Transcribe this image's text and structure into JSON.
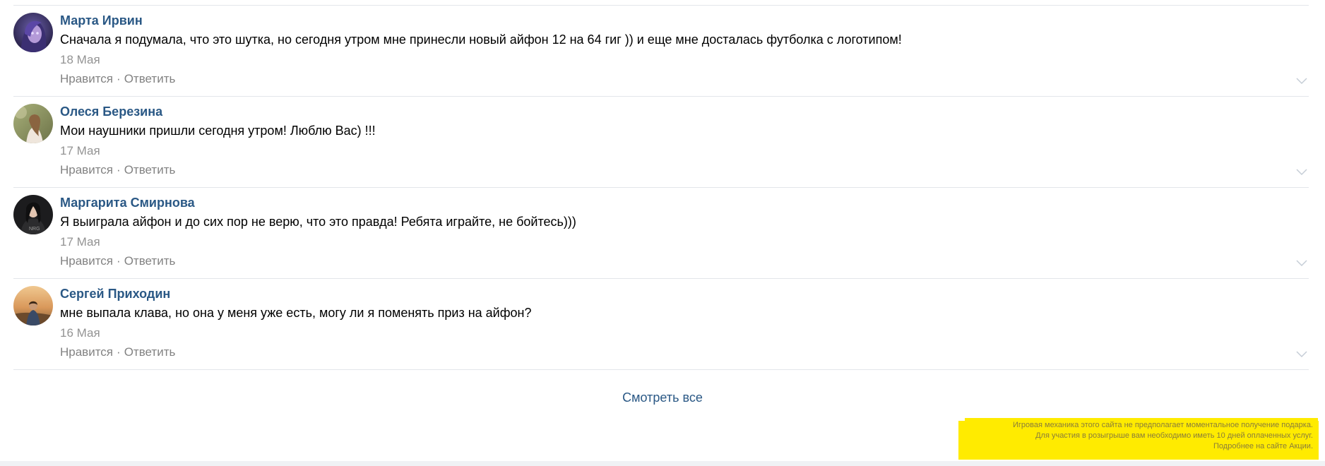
{
  "comments": [
    {
      "author": "Марта Ирвин",
      "text": "Сначала я подумала, что это шутка, но сегодня утром мне принесли новый айфон 12 на 64 гиг )) и еще мне досталась футболка с логотипом!",
      "date": "18 Мая",
      "like": "Нравится",
      "reply": "Ответить",
      "separator": "·"
    },
    {
      "author": "Олеся Березина",
      "text": "Мои наушники пришли сегодня утром! Люблю Вас) !!!",
      "date": "17 Мая",
      "like": "Нравится",
      "reply": "Ответить",
      "separator": "·"
    },
    {
      "author": "Маргарита Смирнова",
      "text": "Я выиграла айфон и до сих пор не верю, что это правда! Ребята играйте, не бойтесь)))",
      "date": "17 Мая",
      "like": "Нравится",
      "reply": "Ответить",
      "separator": "·"
    },
    {
      "author": "Сергей Приходин",
      "text": "мне выпала клава, но она у меня уже есть, могу ли я поменять приз на айфон?",
      "date": "16 Мая",
      "like": "Нравится",
      "reply": "Ответить",
      "separator": "·"
    }
  ],
  "see_all": "Смотреть все",
  "disclaimer": {
    "line1": "Игровая механика этого сайта не предполагает моментальное получение подарка.",
    "line2": "Для участия в розыгрыше вам необходимо иметь 10 дней оплаченных услуг.",
    "line3": "Подробнее на сайте Акции."
  },
  "colors": {
    "author_link": "#2a5885",
    "meta_text": "#939393",
    "divider": "#e3e6ea",
    "disclaimer_bg": "#ffeb00"
  },
  "icons": {
    "expand": "chevron-down-icon"
  }
}
